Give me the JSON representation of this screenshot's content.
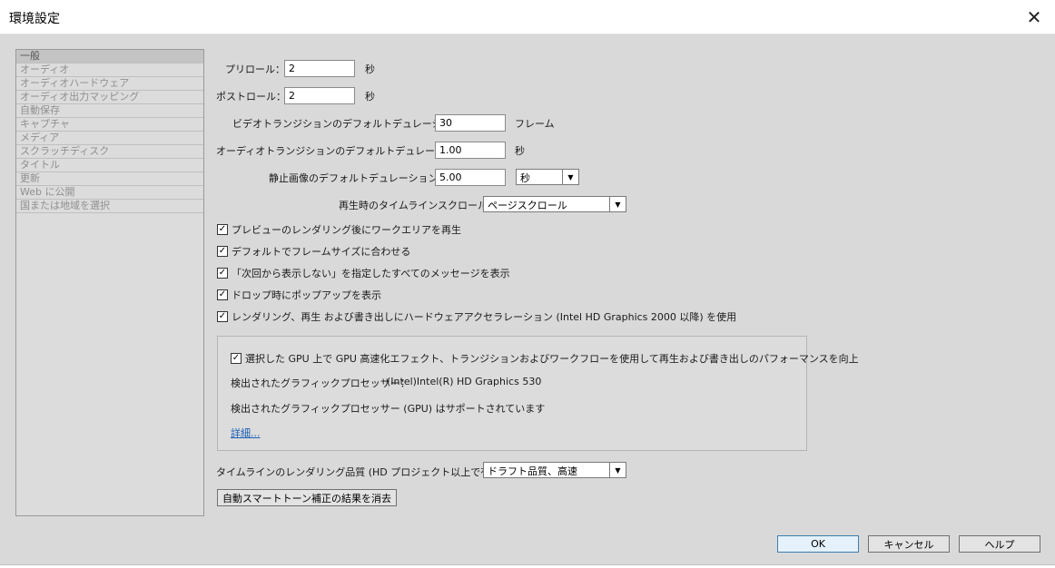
{
  "window": {
    "title": "環境設定",
    "close_glyph": "✕"
  },
  "sidebar": {
    "items": [
      {
        "label": "一般",
        "selected": true
      },
      {
        "label": "オーディオ"
      },
      {
        "label": "オーディオハードウェア"
      },
      {
        "label": "オーディオ出力マッピング"
      },
      {
        "label": "自動保存"
      },
      {
        "label": "キャプチャ"
      },
      {
        "label": "メディア"
      },
      {
        "label": "スクラッチディスク"
      },
      {
        "label": "タイトル"
      },
      {
        "label": "更新"
      },
      {
        "label": "Web に公開"
      },
      {
        "label": "国または地域を選択"
      }
    ]
  },
  "general": {
    "preroll": {
      "label": "プリロール：",
      "value": "2",
      "unit": "秒"
    },
    "postroll": {
      "label": "ポストロール：",
      "value": "2",
      "unit": "秒"
    },
    "video_transition": {
      "label": "ビデオトランジションのデフォルトデュレーション：",
      "value": "30",
      "unit": "フレーム"
    },
    "audio_transition": {
      "label": "オーディオトランジションのデフォルトデュレーション：",
      "value": "1.00",
      "unit": "秒"
    },
    "still_image": {
      "label": "静止画像のデフォルトデュレーション：",
      "value": "5.00",
      "unit_select": "秒"
    },
    "timeline_scroll": {
      "label": "再生時のタイムラインスクロール：",
      "value": "ページスクロール"
    },
    "checkboxes": [
      {
        "label": "プレビューのレンダリング後にワークエリアを再生",
        "checked": true
      },
      {
        "label": "デフォルトでフレームサイズに合わせる",
        "checked": true
      },
      {
        "label": "「次回から表示しない」を指定したすべてのメッセージを表示",
        "checked": true
      },
      {
        "label": "ドロップ時にポップアップを表示",
        "checked": true
      },
      {
        "label": "レンダリング、再生 および書き出しにハードウェアアクセラレーション (Intel HD Graphics 2000 以降) を使用",
        "checked": true
      }
    ],
    "gpu": {
      "checkbox_label": "選択した GPU 上で GPU 高速化エフェクト、トランジションおよびワークフローを使用して再生および書き出しのパフォーマンスを向上",
      "checked": true,
      "detected_label": "検出されたグラフィックプロセッサー：",
      "detected_value": "(Intel)Intel(R) HD Graphics 530",
      "supported_text": "検出されたグラフィックプロセッサー (GPU) はサポートされています",
      "details_link": "詳細..."
    },
    "render_quality": {
      "label": "タイムラインのレンダリング品質 (HD プロジェクト以上で有効)：",
      "value": "ドラフト品質、高速"
    },
    "clear_button": "自動スマートトーン補正の結果を消去"
  },
  "footer": {
    "ok": "OK",
    "cancel": "キャンセル",
    "help": "ヘルプ"
  },
  "glyphs": {
    "check": "✓",
    "dropdown_arrow": "▼"
  }
}
